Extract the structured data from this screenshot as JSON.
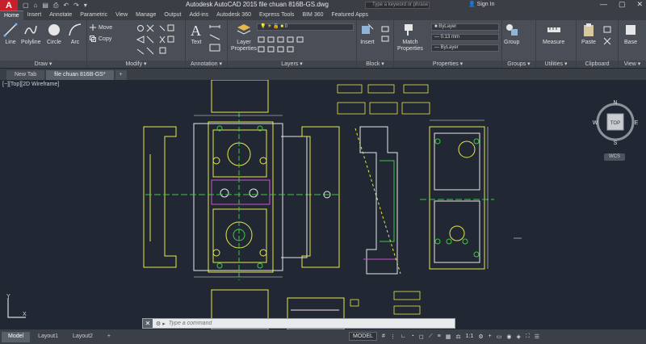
{
  "titlebar": {
    "logo": "A",
    "title": "Autodesk AutoCAD 2015    file chuan 816B-GS.dwg",
    "search_placeholder": "Type a keyword or phrase",
    "signin": "Sign In",
    "quick_access": [
      "▢",
      "⌂",
      "▤",
      "⎙",
      "↶",
      "↷",
      "▾"
    ]
  },
  "ribbon_tabs": [
    "Home",
    "Insert",
    "Annotate",
    "Parametric",
    "View",
    "Manage",
    "Output",
    "Add-ins",
    "Autodesk 360",
    "Express Tools",
    "BIM 360",
    "Featured Apps"
  ],
  "ribbon": {
    "draw": {
      "title": "Draw ▾",
      "tools": [
        "Line",
        "Polyline",
        "Circle",
        "Arc"
      ]
    },
    "modify": {
      "title": "Modify ▾",
      "move": "Move",
      "copy": "Copy"
    },
    "annotation": {
      "title": "Annotation ▾",
      "text": "Text"
    },
    "layers": {
      "title": "Layers ▾",
      "layer_properties": "Layer\nProperties",
      "current_layer": "0"
    },
    "block": {
      "title": "Block ▾",
      "insert": "Insert"
    },
    "properties": {
      "title": "Properties ▾",
      "match": "Match\nProperties",
      "color": "ByLayer",
      "lineweight": "0.13 mm",
      "linetype": "ByLayer"
    },
    "groups": {
      "title": "Groups ▾",
      "group": "Group"
    },
    "utilities": {
      "title": "Utilities ▾",
      "measure": "Measure"
    },
    "clipboard": {
      "title": "Clipboard",
      "paste": "Paste"
    },
    "view": {
      "title": "View ▾",
      "base": "Base"
    }
  },
  "file_tabs": [
    "New Tab",
    "file chuan 816B-GS*",
    "+"
  ],
  "viewport": {
    "label": "[−][Top][2D Wireframe]",
    "compass": {
      "n": "N",
      "s": "S",
      "e": "E",
      "w": "W",
      "top": "TOP"
    },
    "wcs": "WCS",
    "ucs_x": "X",
    "ucs_y": "Y"
  },
  "command": {
    "close": "✕",
    "placeholder": "Type a command"
  },
  "statusbar": {
    "layouts": [
      "Model",
      "Layout1",
      "Layout2",
      "+"
    ],
    "model_button": "MODEL",
    "scale": "1:1"
  },
  "colors": {
    "drawing_bg": "#212834",
    "ribbon_bg": "#4a4f57",
    "yellow_lines": "#e8e84a",
    "white_lines": "#e6e6e6",
    "green_lines": "#3ec93e",
    "magenta_lines": "#d04fd0"
  }
}
